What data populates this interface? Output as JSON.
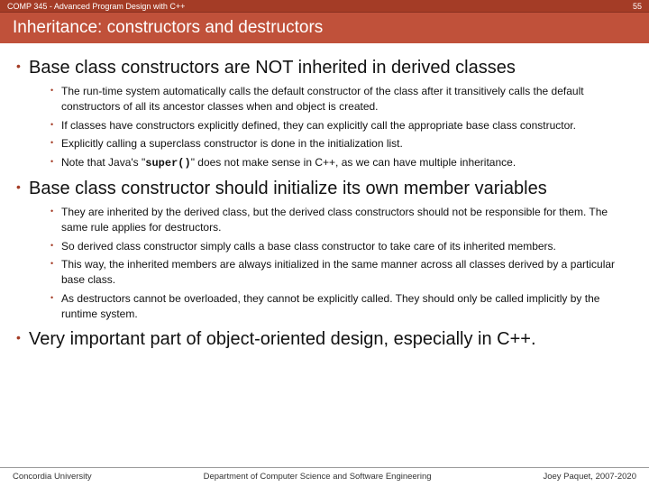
{
  "topbar": {
    "course": "COMP 345 - Advanced Program Design with C++",
    "page": "55"
  },
  "title": "Inheritance: constructors and destructors",
  "points": [
    {
      "heading": "Base class constructors are NOT inherited in derived classes",
      "items": [
        {
          "text": "The run-time system automatically calls the default constructor of the class after it transitively calls the default constructors of all its ancestor classes when and object is created."
        },
        {
          "text": "If classes have constructors explicitly defined, they can explicitly call the appropriate base class constructor."
        },
        {
          "text": "Explicitly calling a superclass constructor is done in the initialization list."
        },
        {
          "pre": "Note that Java's \"",
          "code": "super()",
          "post": "\" does not make sense in C++, as we can have multiple inheritance."
        }
      ]
    },
    {
      "heading": "Base class constructor should initialize its own member variables",
      "items": [
        {
          "text": "They are inherited by the derived class, but the derived class constructors should not be responsible for them. The same rule applies for destructors."
        },
        {
          "text": "So derived class constructor simply calls a base class constructor to take care of its inherited members."
        },
        {
          "text": "This way, the inherited members are always initialized in the same manner across all classes derived by a particular base class."
        },
        {
          "text": "As destructors cannot be overloaded, they cannot be explicitly called. They should only be called implicitly by the runtime system."
        }
      ]
    },
    {
      "heading": "Very important part of object-oriented design, especially in C++.",
      "items": []
    }
  ],
  "footer": {
    "left": "Concordia University",
    "mid": "Department of Computer Science and Software Engineering",
    "right": "Joey Paquet, 2007-2020"
  }
}
